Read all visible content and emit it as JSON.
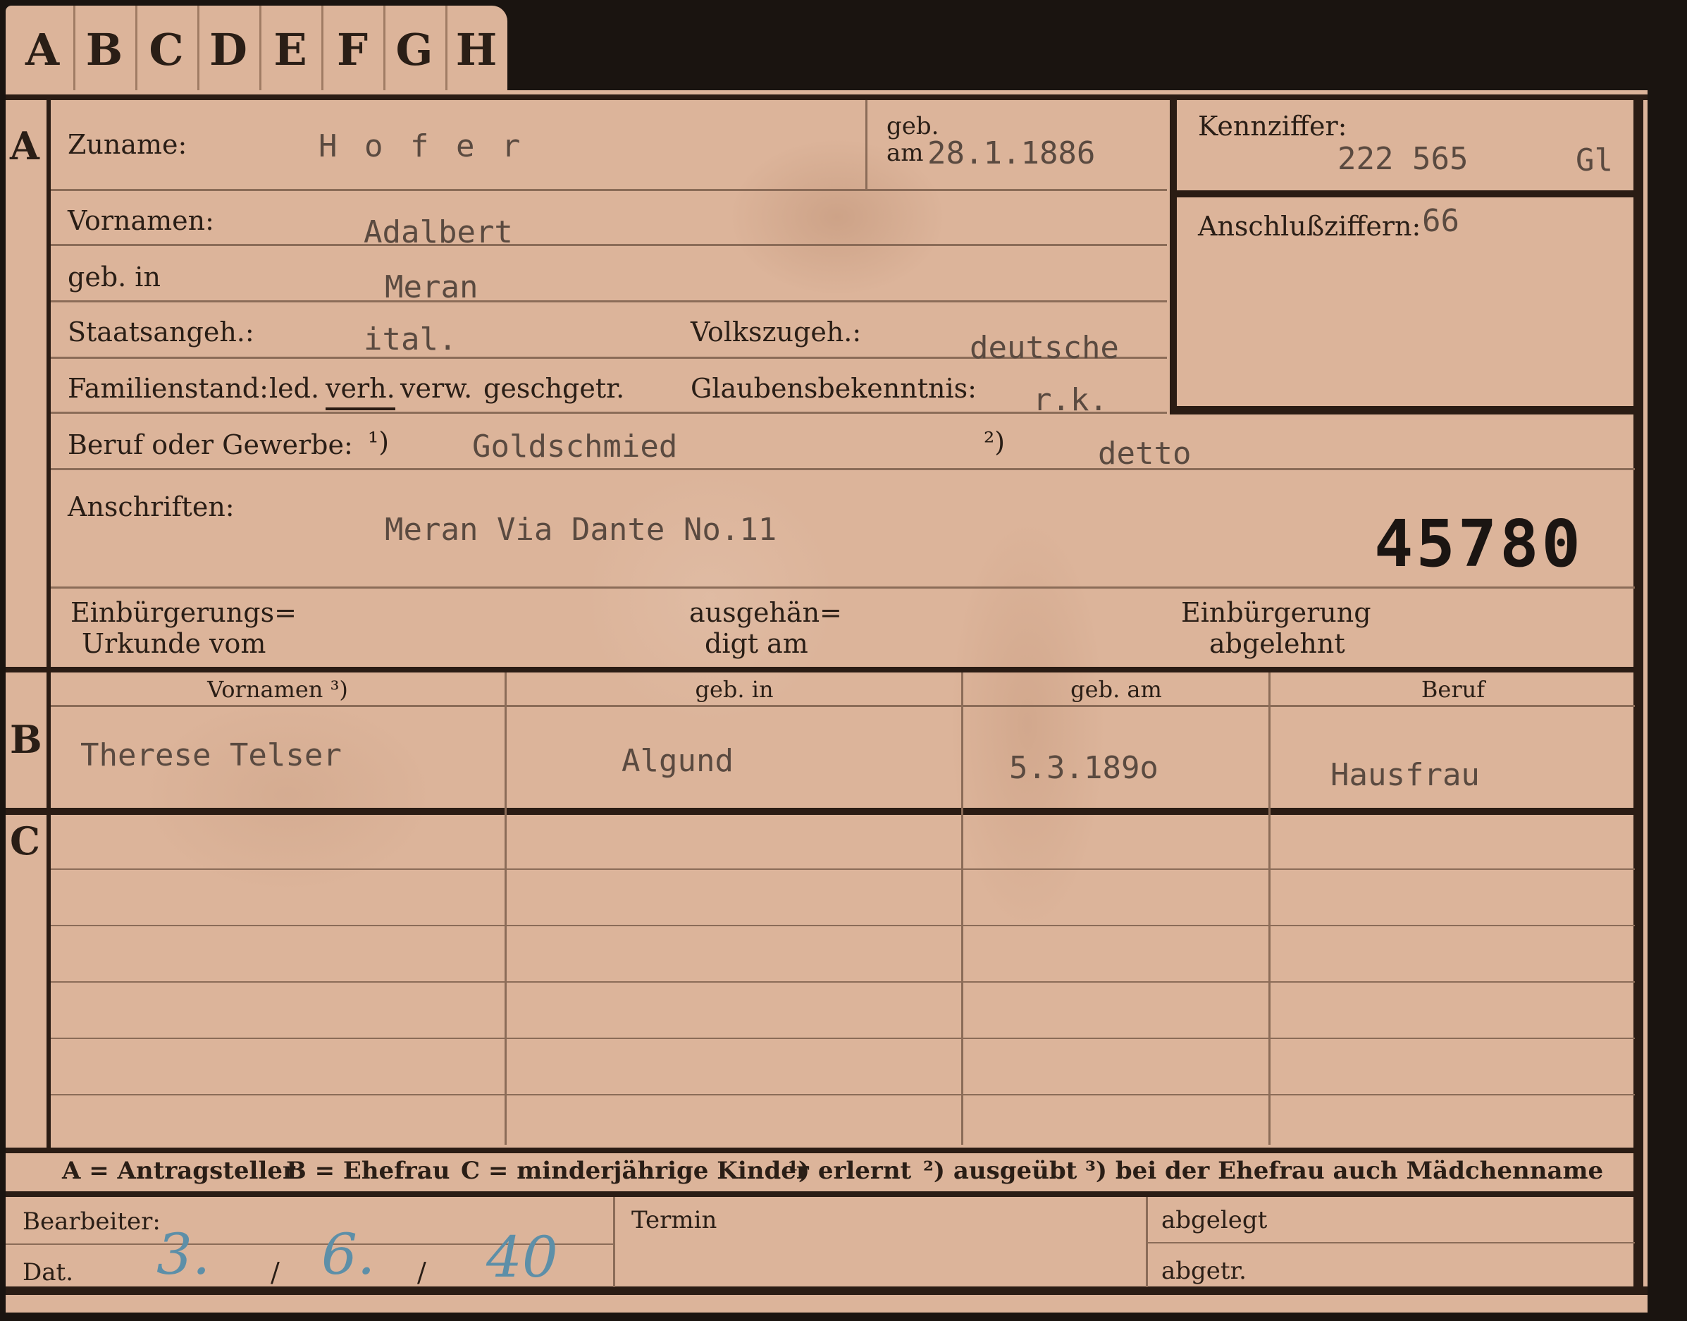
{
  "tabs": [
    "A",
    "B",
    "C",
    "D",
    "E",
    "F",
    "G",
    "H"
  ],
  "section_a": {
    "marker": "A",
    "zuname_label": "Zuname:",
    "zuname_value": "H o f e r",
    "geb_am_label_1": "geb.",
    "geb_am_label_2": "am",
    "geb_am_value": "28.1.1886",
    "kennziffer_label": "Kennziffer:",
    "kennziffer_value": "222 565",
    "kennziffer_suffix": "Gl",
    "vornamen_label": "Vornamen:",
    "vornamen_value": "Adalbert",
    "anschluss_label": "Anschlußziffern:",
    "anschluss_value": "66",
    "geb_in_label": "geb. in",
    "geb_in_value": "Meran",
    "staatsangeh_label": "Staatsangeh.:",
    "staatsangeh_value": "ital.",
    "volkszugeh_label": "Volkszugeh.:",
    "volkszugeh_value": "deutsche",
    "familienstand_label": "Familienstand:",
    "familienstand_options": [
      "led.",
      "verh.",
      "verw.",
      "gesch.",
      "getr."
    ],
    "glauben_label": "Glaubensbekenntnis:",
    "glauben_value": "r.k.",
    "beruf_label": "Beruf oder Gewerbe:",
    "beruf_marker_1": "¹)",
    "beruf_value_1": "Goldschmied",
    "beruf_marker_2": "²)",
    "beruf_value_2": "detto",
    "anschriften_label": "Anschriften:",
    "anschriften_value": "Meran Via Dante No.11",
    "stamp_number": "45780",
    "einb_urkunde_label_1": "Einbürgerungs=",
    "einb_urkunde_label_2": "Urkunde vom",
    "ausgehaendigt_label_1": "ausgehän=",
    "ausgehaendigt_label_2": "digt am",
    "einb_abgelehnt_label_1": "Einbürgerung",
    "einb_abgelehnt_label_2": "abgelehnt"
  },
  "section_b": {
    "marker": "B",
    "headers": [
      "Vornamen ³)",
      "geb. in",
      "geb. am",
      "Beruf"
    ],
    "row": [
      "Therese Telser",
      "Algund",
      "5.3.189o",
      "Hausfrau"
    ]
  },
  "section_c": {
    "marker": "C"
  },
  "legend": {
    "a": "A = Antragsteller",
    "b": "B = Ehefrau",
    "c": "C = minderjährige Kinder",
    "n1": "¹) erlernt",
    "n2": "²) ausgeübt",
    "n3": "³) bei der Ehefrau auch Mädchenname"
  },
  "footer": {
    "bearbeiter_label": "Bearbeiter:",
    "dat_label": "Dat.",
    "dat_day": "3.",
    "dat_sep1": "/",
    "dat_month": "6.",
    "dat_sep2": "/",
    "dat_year": "40",
    "termin_label": "Termin",
    "abgelegt_label": "abgelegt",
    "abgetr_label": "abgetr."
  }
}
